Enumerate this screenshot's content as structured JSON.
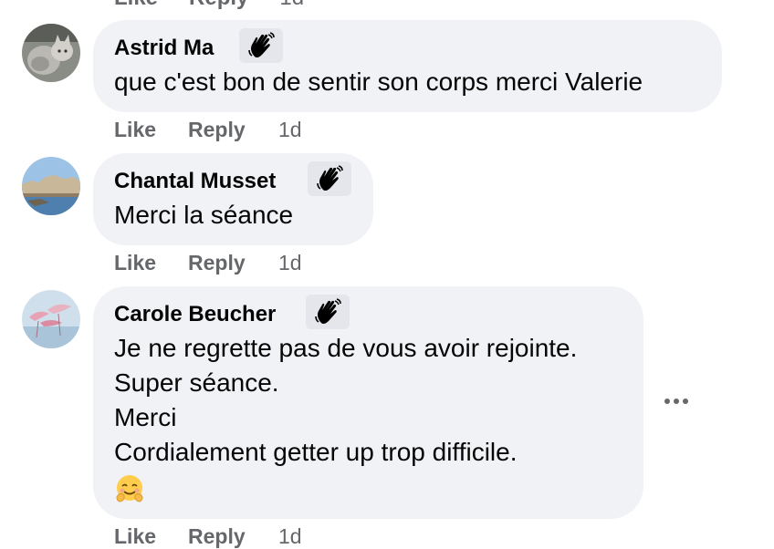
{
  "top_actions": {
    "like": "Like",
    "reply": "Reply",
    "time": "1d"
  },
  "icons": {
    "badge": "wave-hand-icon",
    "more": "more-options-icon",
    "emoji": "smiling-face-with-open-hands-emoji"
  },
  "colors": {
    "bubble": "#f0f2f5",
    "meta_text": "#65676b",
    "badge_bg": "#e4e6eb"
  },
  "comments": [
    {
      "author": "Astrid Ma",
      "lines": [
        "que c'est bon de sentir son corps merci Valerie"
      ],
      "like": "Like",
      "reply": "Reply",
      "time": "1d"
    },
    {
      "author": "Chantal Musset",
      "lines": [
        "Merci la séance"
      ],
      "like": "Like",
      "reply": "Reply",
      "time": "1d"
    },
    {
      "author": "Carole Beucher",
      "lines": [
        "Je ne regrette pas de vous avoir rejointe.",
        "Super séance.",
        "Merci",
        "Cordialement getter up trop difficile."
      ],
      "emoji": "🤗",
      "like": "Like",
      "reply": "Reply",
      "time": "1d"
    }
  ]
}
